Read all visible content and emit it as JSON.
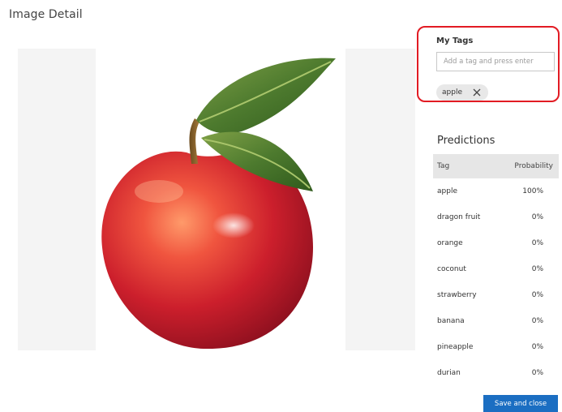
{
  "title": "Image Detail",
  "my_tags": {
    "heading": "My Tags",
    "input_placeholder": "Add a tag and press enter",
    "tags": [
      {
        "label": "apple"
      }
    ],
    "highlight_color": "#e21b23"
  },
  "predictions": {
    "heading": "Predictions",
    "columns": {
      "tag": "Tag",
      "probability": "Probability"
    },
    "rows": [
      {
        "tag": "apple",
        "probability": "100%"
      },
      {
        "tag": "dragon fruit",
        "probability": "0%"
      },
      {
        "tag": "orange",
        "probability": "0%"
      },
      {
        "tag": "coconut",
        "probability": "0%"
      },
      {
        "tag": "strawberry",
        "probability": "0%"
      },
      {
        "tag": "banana",
        "probability": "0%"
      },
      {
        "tag": "pineapple",
        "probability": "0%"
      },
      {
        "tag": "durian",
        "probability": "0%"
      }
    ]
  },
  "actions": {
    "save_label": "Save and close",
    "accent": "#1b6ec2"
  },
  "icons": {
    "chip_remove": "close-icon"
  }
}
